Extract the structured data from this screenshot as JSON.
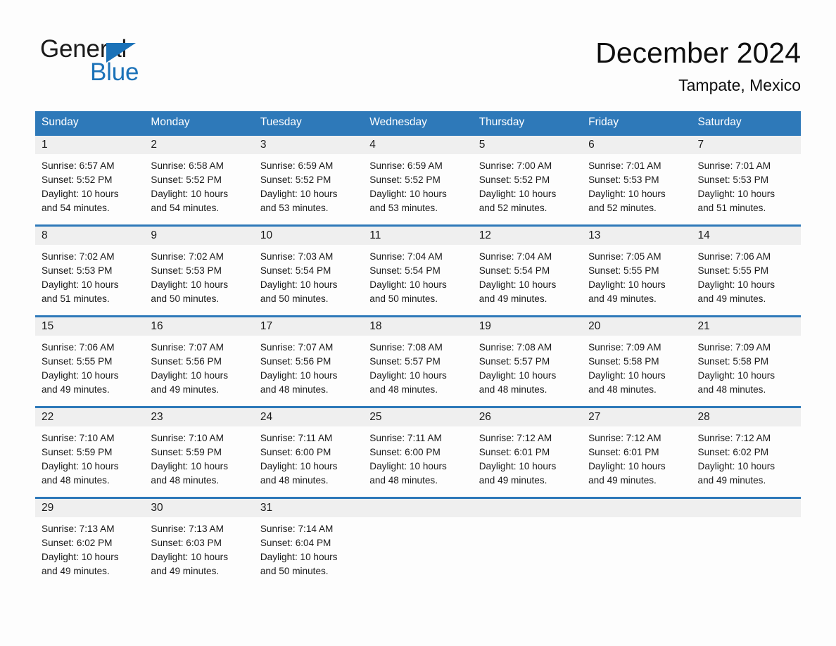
{
  "brand": {
    "name_part1": "General",
    "name_part2": "Blue",
    "accent_color": "#1b72b8"
  },
  "header": {
    "month_title": "December 2024",
    "location": "Tampate, Mexico"
  },
  "theme": {
    "header_row_bg": "#2e79b9",
    "day_band_bg": "#efefef",
    "page_bg": "#fdfdfd",
    "text_color": "#1a1a1a"
  },
  "calendar": {
    "weekday_headers": [
      "Sunday",
      "Monday",
      "Tuesday",
      "Wednesday",
      "Thursday",
      "Friday",
      "Saturday"
    ],
    "weeks": [
      [
        {
          "day": "1",
          "sunrise": "Sunrise: 6:57 AM",
          "sunset": "Sunset: 5:52 PM",
          "daylight_line1": "Daylight: 10 hours",
          "daylight_line2": "and 54 minutes."
        },
        {
          "day": "2",
          "sunrise": "Sunrise: 6:58 AM",
          "sunset": "Sunset: 5:52 PM",
          "daylight_line1": "Daylight: 10 hours",
          "daylight_line2": "and 54 minutes."
        },
        {
          "day": "3",
          "sunrise": "Sunrise: 6:59 AM",
          "sunset": "Sunset: 5:52 PM",
          "daylight_line1": "Daylight: 10 hours",
          "daylight_line2": "and 53 minutes."
        },
        {
          "day": "4",
          "sunrise": "Sunrise: 6:59 AM",
          "sunset": "Sunset: 5:52 PM",
          "daylight_line1": "Daylight: 10 hours",
          "daylight_line2": "and 53 minutes."
        },
        {
          "day": "5",
          "sunrise": "Sunrise: 7:00 AM",
          "sunset": "Sunset: 5:52 PM",
          "daylight_line1": "Daylight: 10 hours",
          "daylight_line2": "and 52 minutes."
        },
        {
          "day": "6",
          "sunrise": "Sunrise: 7:01 AM",
          "sunset": "Sunset: 5:53 PM",
          "daylight_line1": "Daylight: 10 hours",
          "daylight_line2": "and 52 minutes."
        },
        {
          "day": "7",
          "sunrise": "Sunrise: 7:01 AM",
          "sunset": "Sunset: 5:53 PM",
          "daylight_line1": "Daylight: 10 hours",
          "daylight_line2": "and 51 minutes."
        }
      ],
      [
        {
          "day": "8",
          "sunrise": "Sunrise: 7:02 AM",
          "sunset": "Sunset: 5:53 PM",
          "daylight_line1": "Daylight: 10 hours",
          "daylight_line2": "and 51 minutes."
        },
        {
          "day": "9",
          "sunrise": "Sunrise: 7:02 AM",
          "sunset": "Sunset: 5:53 PM",
          "daylight_line1": "Daylight: 10 hours",
          "daylight_line2": "and 50 minutes."
        },
        {
          "day": "10",
          "sunrise": "Sunrise: 7:03 AM",
          "sunset": "Sunset: 5:54 PM",
          "daylight_line1": "Daylight: 10 hours",
          "daylight_line2": "and 50 minutes."
        },
        {
          "day": "11",
          "sunrise": "Sunrise: 7:04 AM",
          "sunset": "Sunset: 5:54 PM",
          "daylight_line1": "Daylight: 10 hours",
          "daylight_line2": "and 50 minutes."
        },
        {
          "day": "12",
          "sunrise": "Sunrise: 7:04 AM",
          "sunset": "Sunset: 5:54 PM",
          "daylight_line1": "Daylight: 10 hours",
          "daylight_line2": "and 49 minutes."
        },
        {
          "day": "13",
          "sunrise": "Sunrise: 7:05 AM",
          "sunset": "Sunset: 5:55 PM",
          "daylight_line1": "Daylight: 10 hours",
          "daylight_line2": "and 49 minutes."
        },
        {
          "day": "14",
          "sunrise": "Sunrise: 7:06 AM",
          "sunset": "Sunset: 5:55 PM",
          "daylight_line1": "Daylight: 10 hours",
          "daylight_line2": "and 49 minutes."
        }
      ],
      [
        {
          "day": "15",
          "sunrise": "Sunrise: 7:06 AM",
          "sunset": "Sunset: 5:55 PM",
          "daylight_line1": "Daylight: 10 hours",
          "daylight_line2": "and 49 minutes."
        },
        {
          "day": "16",
          "sunrise": "Sunrise: 7:07 AM",
          "sunset": "Sunset: 5:56 PM",
          "daylight_line1": "Daylight: 10 hours",
          "daylight_line2": "and 49 minutes."
        },
        {
          "day": "17",
          "sunrise": "Sunrise: 7:07 AM",
          "sunset": "Sunset: 5:56 PM",
          "daylight_line1": "Daylight: 10 hours",
          "daylight_line2": "and 48 minutes."
        },
        {
          "day": "18",
          "sunrise": "Sunrise: 7:08 AM",
          "sunset": "Sunset: 5:57 PM",
          "daylight_line1": "Daylight: 10 hours",
          "daylight_line2": "and 48 minutes."
        },
        {
          "day": "19",
          "sunrise": "Sunrise: 7:08 AM",
          "sunset": "Sunset: 5:57 PM",
          "daylight_line1": "Daylight: 10 hours",
          "daylight_line2": "and 48 minutes."
        },
        {
          "day": "20",
          "sunrise": "Sunrise: 7:09 AM",
          "sunset": "Sunset: 5:58 PM",
          "daylight_line1": "Daylight: 10 hours",
          "daylight_line2": "and 48 minutes."
        },
        {
          "day": "21",
          "sunrise": "Sunrise: 7:09 AM",
          "sunset": "Sunset: 5:58 PM",
          "daylight_line1": "Daylight: 10 hours",
          "daylight_line2": "and 48 minutes."
        }
      ],
      [
        {
          "day": "22",
          "sunrise": "Sunrise: 7:10 AM",
          "sunset": "Sunset: 5:59 PM",
          "daylight_line1": "Daylight: 10 hours",
          "daylight_line2": "and 48 minutes."
        },
        {
          "day": "23",
          "sunrise": "Sunrise: 7:10 AM",
          "sunset": "Sunset: 5:59 PM",
          "daylight_line1": "Daylight: 10 hours",
          "daylight_line2": "and 48 minutes."
        },
        {
          "day": "24",
          "sunrise": "Sunrise: 7:11 AM",
          "sunset": "Sunset: 6:00 PM",
          "daylight_line1": "Daylight: 10 hours",
          "daylight_line2": "and 48 minutes."
        },
        {
          "day": "25",
          "sunrise": "Sunrise: 7:11 AM",
          "sunset": "Sunset: 6:00 PM",
          "daylight_line1": "Daylight: 10 hours",
          "daylight_line2": "and 48 minutes."
        },
        {
          "day": "26",
          "sunrise": "Sunrise: 7:12 AM",
          "sunset": "Sunset: 6:01 PM",
          "daylight_line1": "Daylight: 10 hours",
          "daylight_line2": "and 49 minutes."
        },
        {
          "day": "27",
          "sunrise": "Sunrise: 7:12 AM",
          "sunset": "Sunset: 6:01 PM",
          "daylight_line1": "Daylight: 10 hours",
          "daylight_line2": "and 49 minutes."
        },
        {
          "day": "28",
          "sunrise": "Sunrise: 7:12 AM",
          "sunset": "Sunset: 6:02 PM",
          "daylight_line1": "Daylight: 10 hours",
          "daylight_line2": "and 49 minutes."
        }
      ],
      [
        {
          "day": "29",
          "sunrise": "Sunrise: 7:13 AM",
          "sunset": "Sunset: 6:02 PM",
          "daylight_line1": "Daylight: 10 hours",
          "daylight_line2": "and 49 minutes."
        },
        {
          "day": "30",
          "sunrise": "Sunrise: 7:13 AM",
          "sunset": "Sunset: 6:03 PM",
          "daylight_line1": "Daylight: 10 hours",
          "daylight_line2": "and 49 minutes."
        },
        {
          "day": "31",
          "sunrise": "Sunrise: 7:14 AM",
          "sunset": "Sunset: 6:04 PM",
          "daylight_line1": "Daylight: 10 hours",
          "daylight_line2": "and 50 minutes."
        },
        {
          "day": "",
          "sunrise": "",
          "sunset": "",
          "daylight_line1": "",
          "daylight_line2": ""
        },
        {
          "day": "",
          "sunrise": "",
          "sunset": "",
          "daylight_line1": "",
          "daylight_line2": ""
        },
        {
          "day": "",
          "sunrise": "",
          "sunset": "",
          "daylight_line1": "",
          "daylight_line2": ""
        },
        {
          "day": "",
          "sunrise": "",
          "sunset": "",
          "daylight_line1": "",
          "daylight_line2": ""
        }
      ]
    ]
  }
}
